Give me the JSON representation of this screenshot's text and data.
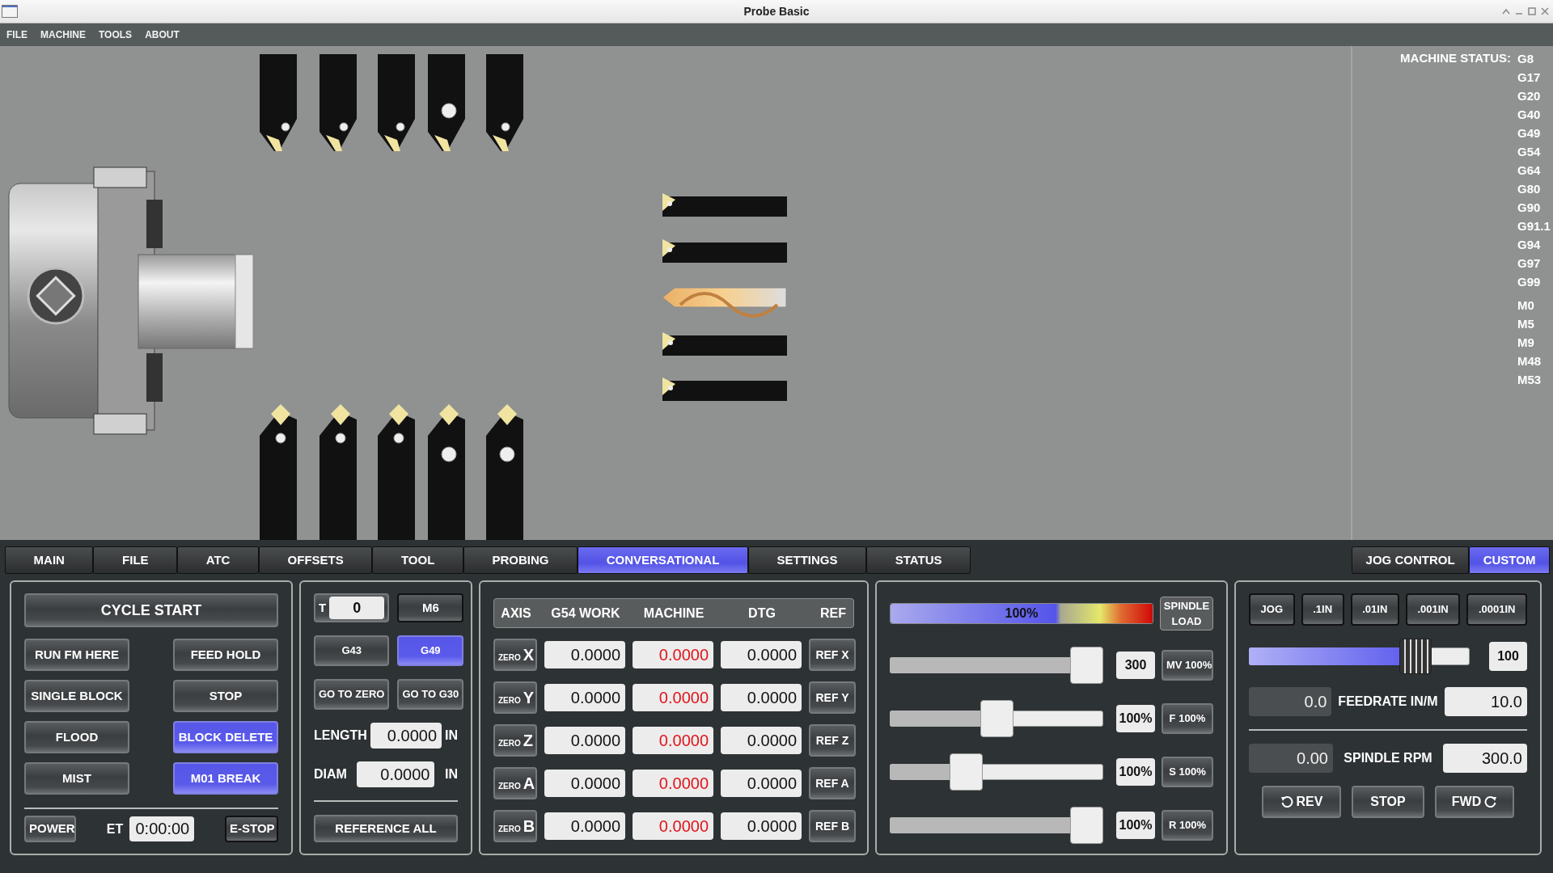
{
  "window": {
    "title": "Probe Basic"
  },
  "menu": [
    "FILE",
    "MACHINE",
    "TOOLS",
    "ABOUT"
  ],
  "machine_status": {
    "label": "MACHINE STATUS:",
    "g_codes": [
      "G8",
      "G17",
      "G20",
      "G40",
      "G49",
      "G54",
      "G64",
      "G80",
      "G90",
      "G91.1",
      "G94",
      "G97",
      "G99"
    ],
    "m_codes": [
      "M0",
      "M5",
      "M9",
      "M48",
      "M53"
    ]
  },
  "tabs": [
    {
      "label": "MAIN",
      "selected": false
    },
    {
      "label": "FILE",
      "selected": false
    },
    {
      "label": "ATC",
      "selected": false
    },
    {
      "label": "OFFSETS",
      "selected": false
    },
    {
      "label": "TOOL",
      "selected": false
    },
    {
      "label": "PROBING",
      "selected": false
    },
    {
      "label": "CONVERSATIONAL",
      "selected": true
    },
    {
      "label": "SETTINGS",
      "selected": false
    },
    {
      "label": "STATUS",
      "selected": false
    }
  ],
  "side_tabs": [
    {
      "label": "JOG CONTROL",
      "selected": false
    },
    {
      "label": "CUSTOM",
      "selected": true
    }
  ],
  "program_control": {
    "cycle_start": "CYCLE START",
    "buttons": [
      {
        "label": "RUN FM HERE",
        "active": false
      },
      {
        "label": "FEED HOLD",
        "active": false
      },
      {
        "label": "SINGLE BLOCK",
        "active": false
      },
      {
        "label": "STOP",
        "active": false
      },
      {
        "label": "FLOOD",
        "active": false
      },
      {
        "label": "BLOCK DELETE",
        "active": true
      },
      {
        "label": "MIST",
        "active": false
      },
      {
        "label": "M01 BREAK",
        "active": true
      }
    ],
    "power": "POWER",
    "et_label": "ET",
    "et_value": "0:00:00",
    "estop": "E-STOP"
  },
  "tool_panel": {
    "t_label": "T",
    "t_value": "0",
    "m6": "M6",
    "buttons": [
      {
        "label": "G43",
        "active": false
      },
      {
        "label": "G49",
        "active": true
      },
      {
        "label": "GO TO ZERO",
        "active": false
      },
      {
        "label": "GO TO G30",
        "active": false
      }
    ],
    "offsets": [
      {
        "label": "LENGTH",
        "value": "0.0000",
        "unit": "IN"
      },
      {
        "label": "DIAM",
        "value": "0.0000",
        "unit": "IN"
      }
    ],
    "reference_all": "REFERENCE ALL"
  },
  "dro": {
    "columns": [
      "AXIS",
      "G54 WORK",
      "MACHINE",
      "DTG",
      "REF"
    ],
    "rows": [
      {
        "zero": "ZERO",
        "axis": "X",
        "work": "0.0000",
        "machine": "0.0000",
        "dtg": "0.0000",
        "ref": "REF X"
      },
      {
        "zero": "ZERO",
        "axis": "Y",
        "work": "0.0000",
        "machine": "0.0000",
        "dtg": "0.0000",
        "ref": "REF Y"
      },
      {
        "zero": "ZERO",
        "axis": "Z",
        "work": "0.0000",
        "machine": "0.0000",
        "dtg": "0.0000",
        "ref": "REF Z"
      },
      {
        "zero": "ZERO",
        "axis": "A",
        "work": "0.0000",
        "machine": "0.0000",
        "dtg": "0.0000",
        "ref": "REF A"
      },
      {
        "zero": "ZERO",
        "axis": "B",
        "work": "0.0000",
        "machine": "0.0000",
        "dtg": "0.0000",
        "ref": "REF B"
      }
    ]
  },
  "overrides": {
    "spindle_load": {
      "level": 1,
      "reading": "100%",
      "label": "SPINDLE LOAD"
    },
    "sliders": [
      {
        "level": 1,
        "reading": "300",
        "button": "MV 100%"
      },
      {
        "level": 0.5,
        "reading": "100%",
        "button": "F 100%"
      },
      {
        "level": 0.33,
        "reading": "100%",
        "button": "S 100%"
      },
      {
        "level": 1,
        "reading": "100%",
        "button": "R 100%"
      }
    ]
  },
  "jog": {
    "increments": [
      "JOG",
      ".1IN",
      ".01IN",
      ".001IN",
      ".0001IN"
    ],
    "slider": {
      "level": 0.8,
      "reading": "100"
    },
    "feed": {
      "current": "0.0",
      "label": "FEEDRATE IN/M",
      "value": "10.0"
    },
    "spindle": {
      "current": "0.00",
      "label": "SPINDLE RPM",
      "value": "300.0"
    },
    "spindle_buttons": [
      {
        "kind": "rev",
        "label": "REV"
      },
      {
        "kind": "stop",
        "label": "STOP"
      },
      {
        "kind": "fwd",
        "label": "FWD"
      }
    ]
  }
}
